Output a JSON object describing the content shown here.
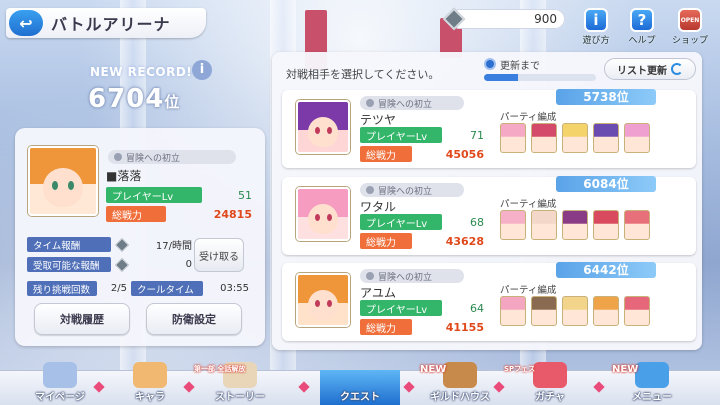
{
  "header": {
    "title": "バトルアリーナ",
    "jewel_count": "900",
    "icons": [
      {
        "label": "遊び方",
        "icon": "info-icon",
        "glyph": "i"
      },
      {
        "label": "ヘルプ",
        "icon": "help-icon",
        "glyph": "?"
      },
      {
        "label": "ショップ",
        "icon": "shop-open-icon",
        "glyph": "OPEN"
      }
    ]
  },
  "record": {
    "label": "NEW RECORD!",
    "value": "6704",
    "unit": "位"
  },
  "player": {
    "title": "冒険への初立",
    "name": "■落落",
    "lv_label": "プレイヤーLv",
    "lv": "51",
    "power_label": "総戦力",
    "power": "24815",
    "time_reward_label": "タイム報酬",
    "time_reward_value": "17/時間",
    "receivable_label": "受取可能な報酬",
    "receivable_value": "0",
    "receive_button": "受け取る",
    "remaining_label": "残り挑戦回数",
    "remaining_value": "2/5",
    "cooltime_label": "クールタイム",
    "cooltime_value": "03:55",
    "history_button": "対戦履歴",
    "defense_button": "防衛設定"
  },
  "opponents_panel": {
    "instruction": "対戦相手を選択してください。",
    "timer_label": "更新まで",
    "timer_progress": 0.3,
    "refresh_button": "リスト更新",
    "party_label": "パーティ編成"
  },
  "opponents": [
    {
      "rank": "5738位",
      "title": "冒険への初立",
      "name": "テツヤ",
      "lv_label": "プレイヤーLv",
      "lv": "71",
      "power_label": "総戦力",
      "power": "45056",
      "avatar_colors": [
        "#7b3aa8",
        "#ffd6d6"
      ],
      "party_colors": [
        "#f6a9c4",
        "#d44a6a",
        "#f5d36b",
        "#6a4bb0",
        "#f0a0d0"
      ]
    },
    {
      "rank": "6084位",
      "title": "冒険への初立",
      "name": "ワタル",
      "lv_label": "プレイヤーLv",
      "lv": "68",
      "power_label": "総戦力",
      "power": "43628",
      "avatar_colors": [
        "#f59cc0",
        "#ffe0e0"
      ],
      "party_colors": [
        "#f6b0c8",
        "#f3d7c8",
        "#8a3b86",
        "#d94a5e",
        "#e8707a"
      ]
    },
    {
      "rank": "6442位",
      "title": "冒険への初立",
      "name": "アユム",
      "lv_label": "プレイヤーLv",
      "lv": "64",
      "power_label": "総戦力",
      "power": "41155",
      "avatar_colors": [
        "#f0963a",
        "#ffe2c9"
      ],
      "party_colors": [
        "#f4a6c0",
        "#8a6a50",
        "#f2d58a",
        "#f0a44a",
        "#e6667a"
      ]
    }
  ],
  "nav": [
    {
      "label": "マイページ",
      "icon": "my-page-icon",
      "badge": ""
    },
    {
      "label": "キャラ",
      "icon": "character-icon",
      "badge": ""
    },
    {
      "label": "ストーリー",
      "icon": "story-icon",
      "badge": "第一部 全話解放"
    },
    {
      "label": "クエスト",
      "icon": "quest-icon",
      "badge": ""
    },
    {
      "label": "ギルドハウス",
      "icon": "guild-house-icon",
      "badge": "NEW"
    },
    {
      "label": "ガチャ",
      "icon": "gacha-icon",
      "badge": "SPフェス"
    },
    {
      "label": "メニュー",
      "icon": "menu-icon",
      "badge": "NEW"
    }
  ],
  "colors": {
    "accent_blue": "#1f6fcf",
    "level_green": "#33b56a",
    "power_orange": "#ef6e3a",
    "nav_diamond": "#e94c7a"
  }
}
